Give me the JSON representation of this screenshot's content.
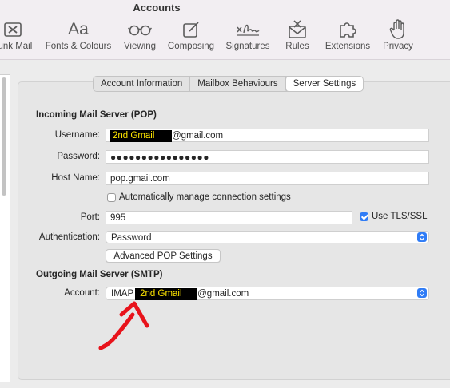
{
  "window": {
    "title": "Accounts"
  },
  "toolbar": {
    "items": [
      {
        "label": "Junk Mail",
        "icon": "junk-mail-icon"
      },
      {
        "label": "Fonts & Colours",
        "icon": "fonts-icon",
        "glyph": "Aa"
      },
      {
        "label": "Viewing",
        "icon": "glasses-icon"
      },
      {
        "label": "Composing",
        "icon": "compose-icon"
      },
      {
        "label": "Signatures",
        "icon": "signature-icon"
      },
      {
        "label": "Rules",
        "icon": "rules-icon"
      },
      {
        "label": "Extensions",
        "icon": "puzzle-icon"
      },
      {
        "label": "Privacy",
        "icon": "hand-icon"
      }
    ]
  },
  "tabs": [
    {
      "label": "Account Information",
      "active": false
    },
    {
      "label": "Mailbox Behaviours",
      "active": false
    },
    {
      "label": "Server Settings",
      "active": true
    }
  ],
  "incoming": {
    "title": "Incoming Mail Server (POP)",
    "username_label": "Username:",
    "username_redacted": "2nd Gmail",
    "username_suffix": "@gmail.com",
    "password_label": "Password:",
    "password_value": "●●●●●●●●●●●●●●●●",
    "hostname_label": "Host Name:",
    "hostname_value": "pop.gmail.com",
    "auto_manage_label": "Automatically manage connection settings",
    "auto_manage_checked": false,
    "port_label": "Port:",
    "port_value": "995",
    "tls_label": "Use TLS/SSL",
    "tls_checked": true,
    "auth_label": "Authentication:",
    "auth_value": "Password",
    "advanced_button": "Advanced POP Settings"
  },
  "outgoing": {
    "title": "Outgoing Mail Server (SMTP)",
    "account_label": "Account:",
    "account_prefix": "IMAP",
    "account_redacted": "2nd Gmail",
    "account_suffix": "@gmail.com"
  },
  "colors": {
    "accent": "#2f7cf6",
    "annotation": "#e8131b",
    "redaction_text": "#ffe600"
  }
}
